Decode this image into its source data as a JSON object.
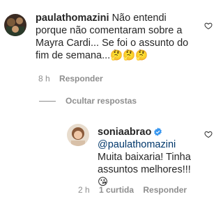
{
  "comment": {
    "username": "paulathomazini",
    "text": "Não entendi porque não comentaram sobre a Mayra Cardi... Se foi o assunto do fim de semana...🤔🤔🤔",
    "time": "8 h",
    "reply_label": "Responder"
  },
  "hide_replies_label": "Ocultar respostas",
  "reply": {
    "username": "soniaabrao",
    "mention": "@paulathomazini",
    "text": " Muita baixaria! Tinha assuntos melhores!!! 😘",
    "time": "2 h",
    "likes": "1 curtida",
    "reply_label": "Responder"
  },
  "colors": {
    "text": "#262626",
    "meta": "#8e8e8e",
    "mention": "#00376b",
    "verified": "#3897f0"
  },
  "icons": [
    "heart-outline-icon",
    "verified-badge-icon"
  ]
}
